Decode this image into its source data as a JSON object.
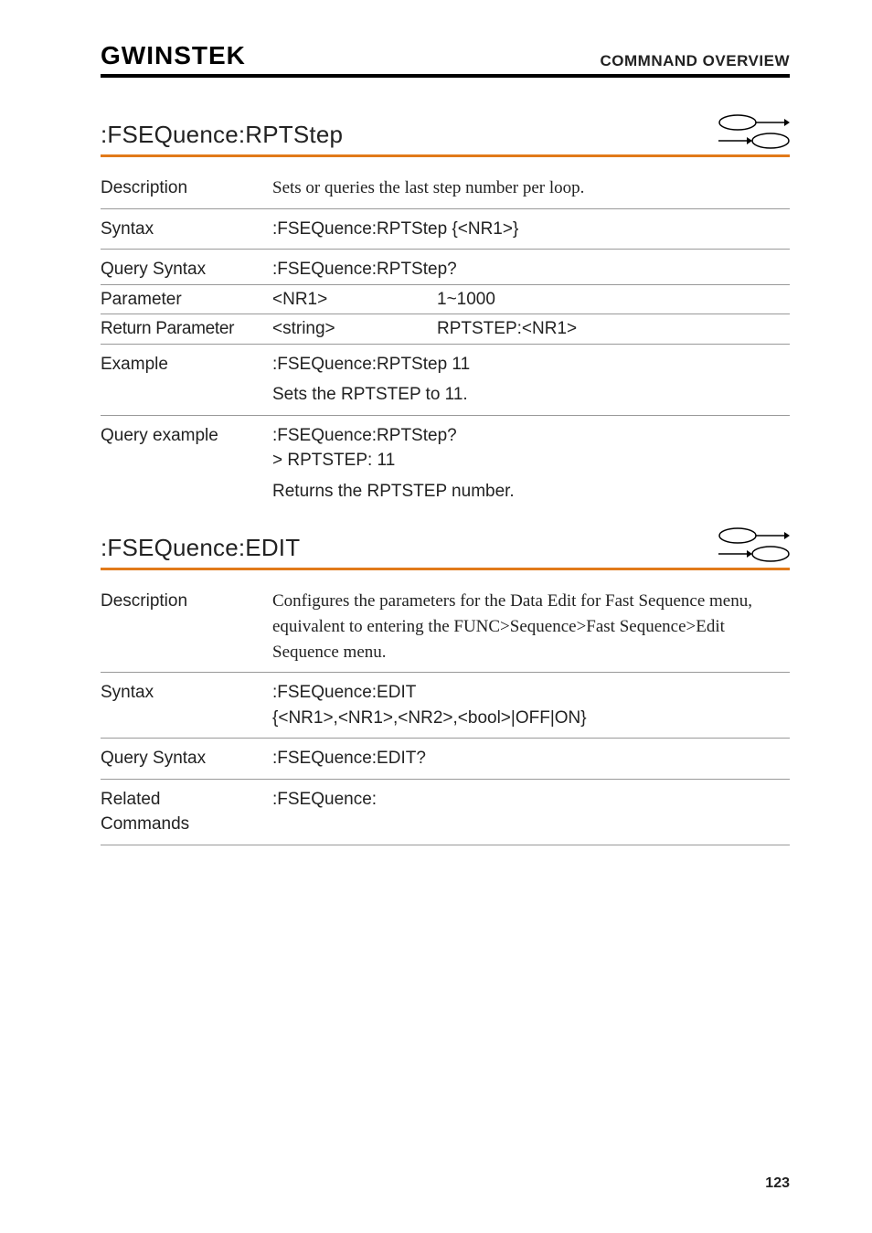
{
  "header": {
    "logo": "GWINSTEK",
    "section": "COMMNAND OVERVIEW"
  },
  "commands": [
    {
      "title": ":FSEQuence:RPTStep",
      "rows": {
        "description": {
          "label": "Description",
          "value": "Sets or queries the last step number per loop."
        },
        "syntax": {
          "label": "Syntax",
          "value": ":FSEQuence:RPTStep {<NR1>}"
        },
        "query_syntax": {
          "label": "Query Syntax",
          "value": ":FSEQuence:RPTStep?"
        },
        "parameter": {
          "label": "Parameter",
          "c1": "<NR1>",
          "c2": "1~1000"
        },
        "return_parameter": {
          "label": "Return Parameter",
          "c1": "<string>",
          "c2": "RPTSTEP:<NR1>"
        },
        "example": {
          "label": "Example",
          "value": ":FSEQuence:RPTStep 11",
          "sub": "Sets the RPTSTEP to 11."
        },
        "query_example": {
          "label": "Query example",
          "value": ":FSEQuence:RPTStep?\n> RPTSTEP: 11",
          "sub": "Returns the RPTSTEP number."
        }
      }
    },
    {
      "title": ":FSEQuence:EDIT",
      "rows": {
        "description": {
          "label": "Description",
          "value": "Configures the parameters for the Data Edit for Fast Sequence menu, equivalent to entering the FUNC>Sequence>Fast Sequence>Edit Sequence menu."
        },
        "syntax": {
          "label": "Syntax",
          "value": ":FSEQuence:EDIT\n{<NR1>,<NR1>,<NR2>,<bool>|OFF|ON}"
        },
        "query_syntax": {
          "label": "Query Syntax",
          "value": ":FSEQuence:EDIT?"
        },
        "related_commands": {
          "label": "Related\nCommands",
          "value": ":FSEQuence:"
        }
      }
    }
  ],
  "page_number": "123"
}
